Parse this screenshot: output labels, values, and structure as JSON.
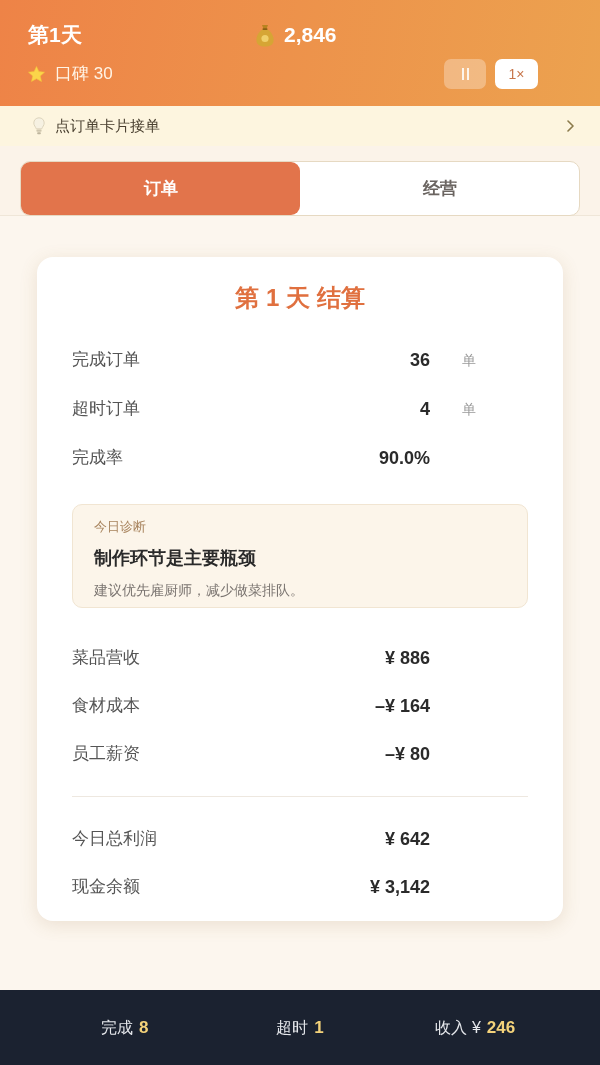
{
  "header": {
    "day": "第1天",
    "cash": "2,846",
    "reputation": "口碑 30",
    "speed": "1×"
  },
  "hint": {
    "text": "点订单卡片接单"
  },
  "tabs": [
    {
      "label": "订单",
      "selected": true
    },
    {
      "label": "经营",
      "selected": false
    }
  ],
  "settlement": {
    "title": "第 1 天 结算",
    "order_stats": [
      {
        "label": "完成订单",
        "value": "36",
        "unit": "单"
      },
      {
        "label": "超时订单",
        "value": "4",
        "unit": "单"
      },
      {
        "label": "完成率",
        "value": "90.0%"
      }
    ],
    "diagnosis": {
      "label": "今日诊断",
      "headline": "制作环节是主要瓶颈",
      "advice": "建议优先雇厨师，减少做菜排队。"
    },
    "finances": [
      {
        "label": "菜品营收",
        "value": "¥ 886"
      },
      {
        "label": "食材成本",
        "value": "–¥ 164"
      },
      {
        "label": "员工薪资",
        "value": "–¥ 80"
      }
    ],
    "totals": [
      {
        "label": "今日总利润",
        "value": "¥ 642"
      },
      {
        "label": "现金余额",
        "value": "¥ 3,142"
      }
    ]
  },
  "status_bar": [
    {
      "label": "完成",
      "value": "8"
    },
    {
      "label": "超时",
      "value": "1"
    },
    {
      "label": "收入 ¥",
      "value": "246"
    }
  ]
}
